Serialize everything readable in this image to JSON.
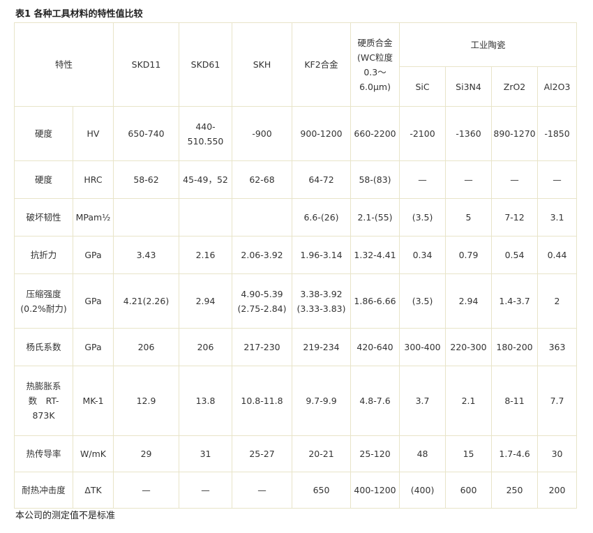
{
  "title": "表1 各种工具材料的特性值比较",
  "header": {
    "property": "特性",
    "skd11": "SKD11",
    "skd61": "SKD61",
    "skh": "SKH",
    "kf2": "KF2合金",
    "hard_alloy_1": "硬质合金",
    "hard_alloy_2": "(WC粒度",
    "hard_alloy_3": "0.3～",
    "hard_alloy_4": "6.0μm)",
    "ceramics": "工业陶瓷",
    "sic": "SiC",
    "si3n4": "Si3N4",
    "zro2": "ZrO2",
    "al2o3": "Al2O3"
  },
  "rows": [
    {
      "name": "硬度",
      "unit": "HV",
      "values": [
        "650-740",
        "440-510.550",
        "-900",
        "900-1200",
        "660-2200",
        "-2100",
        "-1360",
        "890-1270",
        "-1850"
      ]
    },
    {
      "name": "硬度",
      "unit": "HRC",
      "values": [
        "58-62",
        "45-49，52",
        "62-68",
        "64-72",
        "58-(83)",
        "—",
        "—",
        "—",
        "—"
      ]
    },
    {
      "name": "破坏韧性",
      "unit": "MPam½",
      "values": [
        "",
        "",
        "",
        "6.6-(26)",
        "2.1-(55)",
        "(3.5)",
        "5",
        "7-12",
        "3.1"
      ]
    },
    {
      "name": "抗折力",
      "unit": "GPa",
      "values": [
        "3.43",
        "2.16",
        "2.06-3.92",
        "1.96-3.14",
        "1.32-4.41",
        "0.34",
        "0.79",
        "0.54",
        "0.44"
      ]
    },
    {
      "name": "压缩强度",
      "name2": "(0.2%耐力)",
      "unit": "GPa",
      "values": [
        "4.21(2.26)",
        "2.94",
        "4.90-5.39",
        "3.38-3.92",
        "1.86-6.66",
        "(3.5)",
        "2.94",
        "1.4-3.7",
        "2"
      ],
      "values2": [
        "",
        "",
        "(2.75-2.84)",
        "(3.33-3.83)"
      ]
    },
    {
      "name": "杨氏系数",
      "unit": "GPa",
      "values": [
        "206",
        "206",
        "217-230",
        "219-234",
        "420-640",
        "300-400",
        "220-300",
        "180-200",
        "363"
      ]
    },
    {
      "name": "热膨胀系",
      "name2": "数　RT-",
      "name3": "873K",
      "unit": "MK-1",
      "values": [
        "12.9",
        "13.8",
        "10.8-11.8",
        "9.7-9.9",
        "4.8-7.6",
        "3.7",
        "2.1",
        "8-11",
        "7.7"
      ]
    },
    {
      "name": "热传导率",
      "unit": "W/mK",
      "values": [
        "29",
        "31",
        "25-27",
        "20-21",
        "25-120",
        "48",
        "15",
        "1.7-4.6",
        "30"
      ]
    },
    {
      "name": "耐热冲击度",
      "unit": "ΔTK",
      "values": [
        "—",
        "—",
        "—",
        "650",
        "400-1200",
        "(400)",
        "600",
        "250",
        "200"
      ]
    }
  ],
  "footnote": "本公司的测定值不是标准"
}
